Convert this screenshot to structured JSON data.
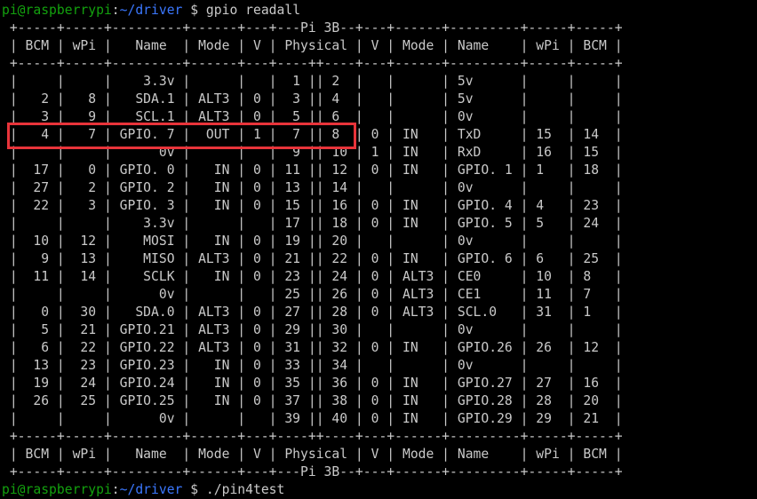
{
  "prompt_user": "pi@raspberrypi",
  "prompt_sep": ":",
  "prompt_path": "~/driver",
  "prompt_symbol": " $ ",
  "command_1": "gpio readall",
  "command_2": "./pin4test",
  "highlight_color": "#e8343a",
  "table_lines": [
    " +-----+-----+---------+------+---+---Pi 3B--+---+------+---------+-----+-----+",
    " | BCM | wPi |   Name  | Mode | V | Physical | V | Mode | Name    | wPi | BCM |",
    " +-----+-----+---------+------+---+----++----+---+------+---------+-----+-----+",
    " |     |     |    3.3v |      |   |  1 || 2  |   |      | 5v      |     |     |",
    " |   2 |   8 |   SDA.1 | ALT3 | 0 |  3 || 4  |   |      | 5v      |     |     |",
    " |   3 |   9 |   SCL.1 | ALT3 | 0 |  5 || 6  |   |      | 0v      |     |     |",
    " |   4 |   7 | GPIO. 7 |  OUT | 1 |  7 || 8  | 0 | IN   | TxD     | 15  | 14  |",
    " |     |     |      0v |      |   |  9 || 10 | 1 | IN   | RxD     | 16  | 15  |",
    " |  17 |   0 | GPIO. 0 |   IN | 0 | 11 || 12 | 0 | IN   | GPIO. 1 | 1   | 18  |",
    " |  27 |   2 | GPIO. 2 |   IN | 0 | 13 || 14 |   |      | 0v      |     |     |",
    " |  22 |   3 | GPIO. 3 |   IN | 0 | 15 || 16 | 0 | IN   | GPIO. 4 | 4   | 23  |",
    " |     |     |    3.3v |      |   | 17 || 18 | 0 | IN   | GPIO. 5 | 5   | 24  |",
    " |  10 |  12 |    MOSI |   IN | 0 | 19 || 20 |   |      | 0v      |     |     |",
    " |   9 |  13 |    MISO | ALT3 | 0 | 21 || 22 | 0 | IN   | GPIO. 6 | 6   | 25  |",
    " |  11 |  14 |    SCLK |   IN | 0 | 23 || 24 | 0 | ALT3 | CE0     | 10  | 8   |",
    " |     |     |      0v |      |   | 25 || 26 | 0 | ALT3 | CE1     | 11  | 7   |",
    " |   0 |  30 |   SDA.0 | ALT3 | 0 | 27 || 28 | 0 | ALT3 | SCL.0   | 31  | 1   |",
    " |   5 |  21 | GPIO.21 | ALT3 | 0 | 29 || 30 |   |      | 0v      |     |     |",
    " |   6 |  22 | GPIO.22 | ALT3 | 0 | 31 || 32 | 0 | IN   | GPIO.26 | 26  | 12  |",
    " |  13 |  23 | GPIO.23 |   IN | 0 | 33 || 34 |   |      | 0v      |     |     |",
    " |  19 |  24 | GPIO.24 |   IN | 0 | 35 || 36 | 0 | IN   | GPIO.27 | 27  | 16  |",
    " |  26 |  25 | GPIO.25 |   IN | 0 | 37 || 38 | 0 | IN   | GPIO.28 | 28  | 20  |",
    " |     |     |      0v |      |   | 39 || 40 | 0 | IN   | GPIO.29 | 29  | 21  |",
    " +-----+-----+---------+------+---+----++----+---+------+---------+-----+-----+",
    " | BCM | wPi |   Name  | Mode | V | Physical | V | Mode | Name    | wPi | BCM |",
    " +-----+-----+---------+------+---+---Pi 3B--+---+------+---------+-----+-----+"
  ]
}
